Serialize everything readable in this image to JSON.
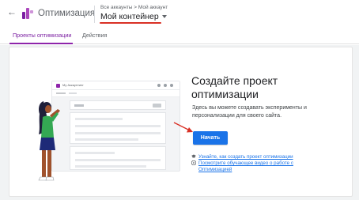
{
  "header": {
    "app_title": "Оптимизация",
    "breadcrumb": "Все аккаунты > Мой аккаунт",
    "container_name": "Мой контейнер"
  },
  "tabs": [
    {
      "label": "Проекты оптимизации",
      "active": true
    },
    {
      "label": "Действия",
      "active": false
    }
  ],
  "illustration": {
    "window_title": "My Аккаунтинг"
  },
  "main": {
    "title": "Создайте проект оптимизации",
    "description": "Здесь вы можете создавать эксперименты и персонализации для своего сайта.",
    "start_button": "Начать",
    "links": [
      {
        "icon": "school-icon",
        "label": "Узнайте, как создать проект оптимизации"
      },
      {
        "icon": "video-icon",
        "label": "Посмотрите обучающее видео о работе с Оптимизацией"
      }
    ]
  },
  "colors": {
    "accent": "#8e24aa",
    "primary_button": "#1a73e8",
    "annotation_red": "#d93025"
  }
}
